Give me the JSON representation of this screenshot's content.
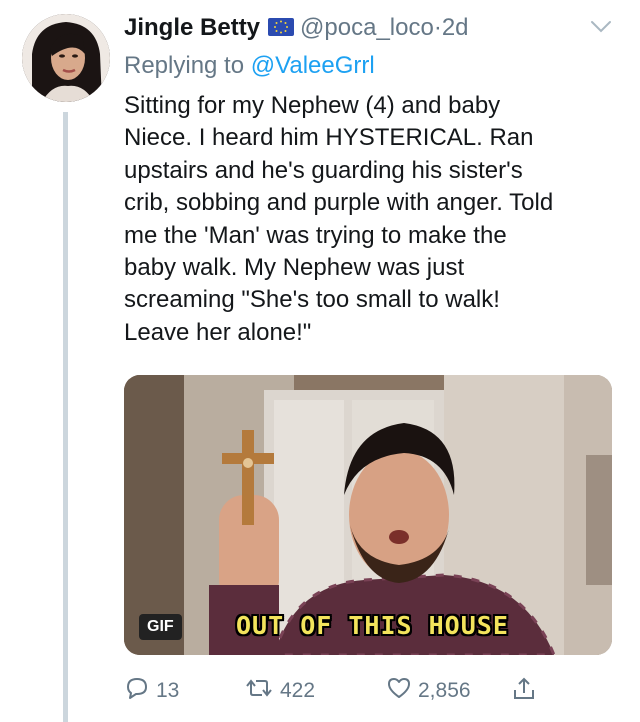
{
  "tweet": {
    "display_name": "Jingle Betty",
    "flag_icon": "eu-flag-icon",
    "handle": "@poca_loco",
    "separator": "·",
    "time": "2d",
    "reply_prefix": "Replying to",
    "reply_to": "@ValeeGrrl",
    "text_lines": [
      "Sitting for my Nephew (4) and baby",
      "Niece. I heard him HYSTERICAL. Ran",
      "upstairs and he's guarding his sister's",
      "crib, sobbing and purple with anger. Told",
      "me the 'Man' was trying to make the",
      "baby walk. My Nephew was just",
      "screaming \"She's too small to walk!",
      "Leave her alone!\""
    ],
    "media": {
      "badge": "GIF",
      "caption": "OUT OF THIS HOUSE"
    },
    "actions": {
      "replies": "13",
      "retweets": "422",
      "likes": "2,856"
    }
  },
  "colors": {
    "accent": "#1da1f2",
    "muted": "#657786",
    "text": "#14171a",
    "thread_line": "#ccd6dd"
  }
}
